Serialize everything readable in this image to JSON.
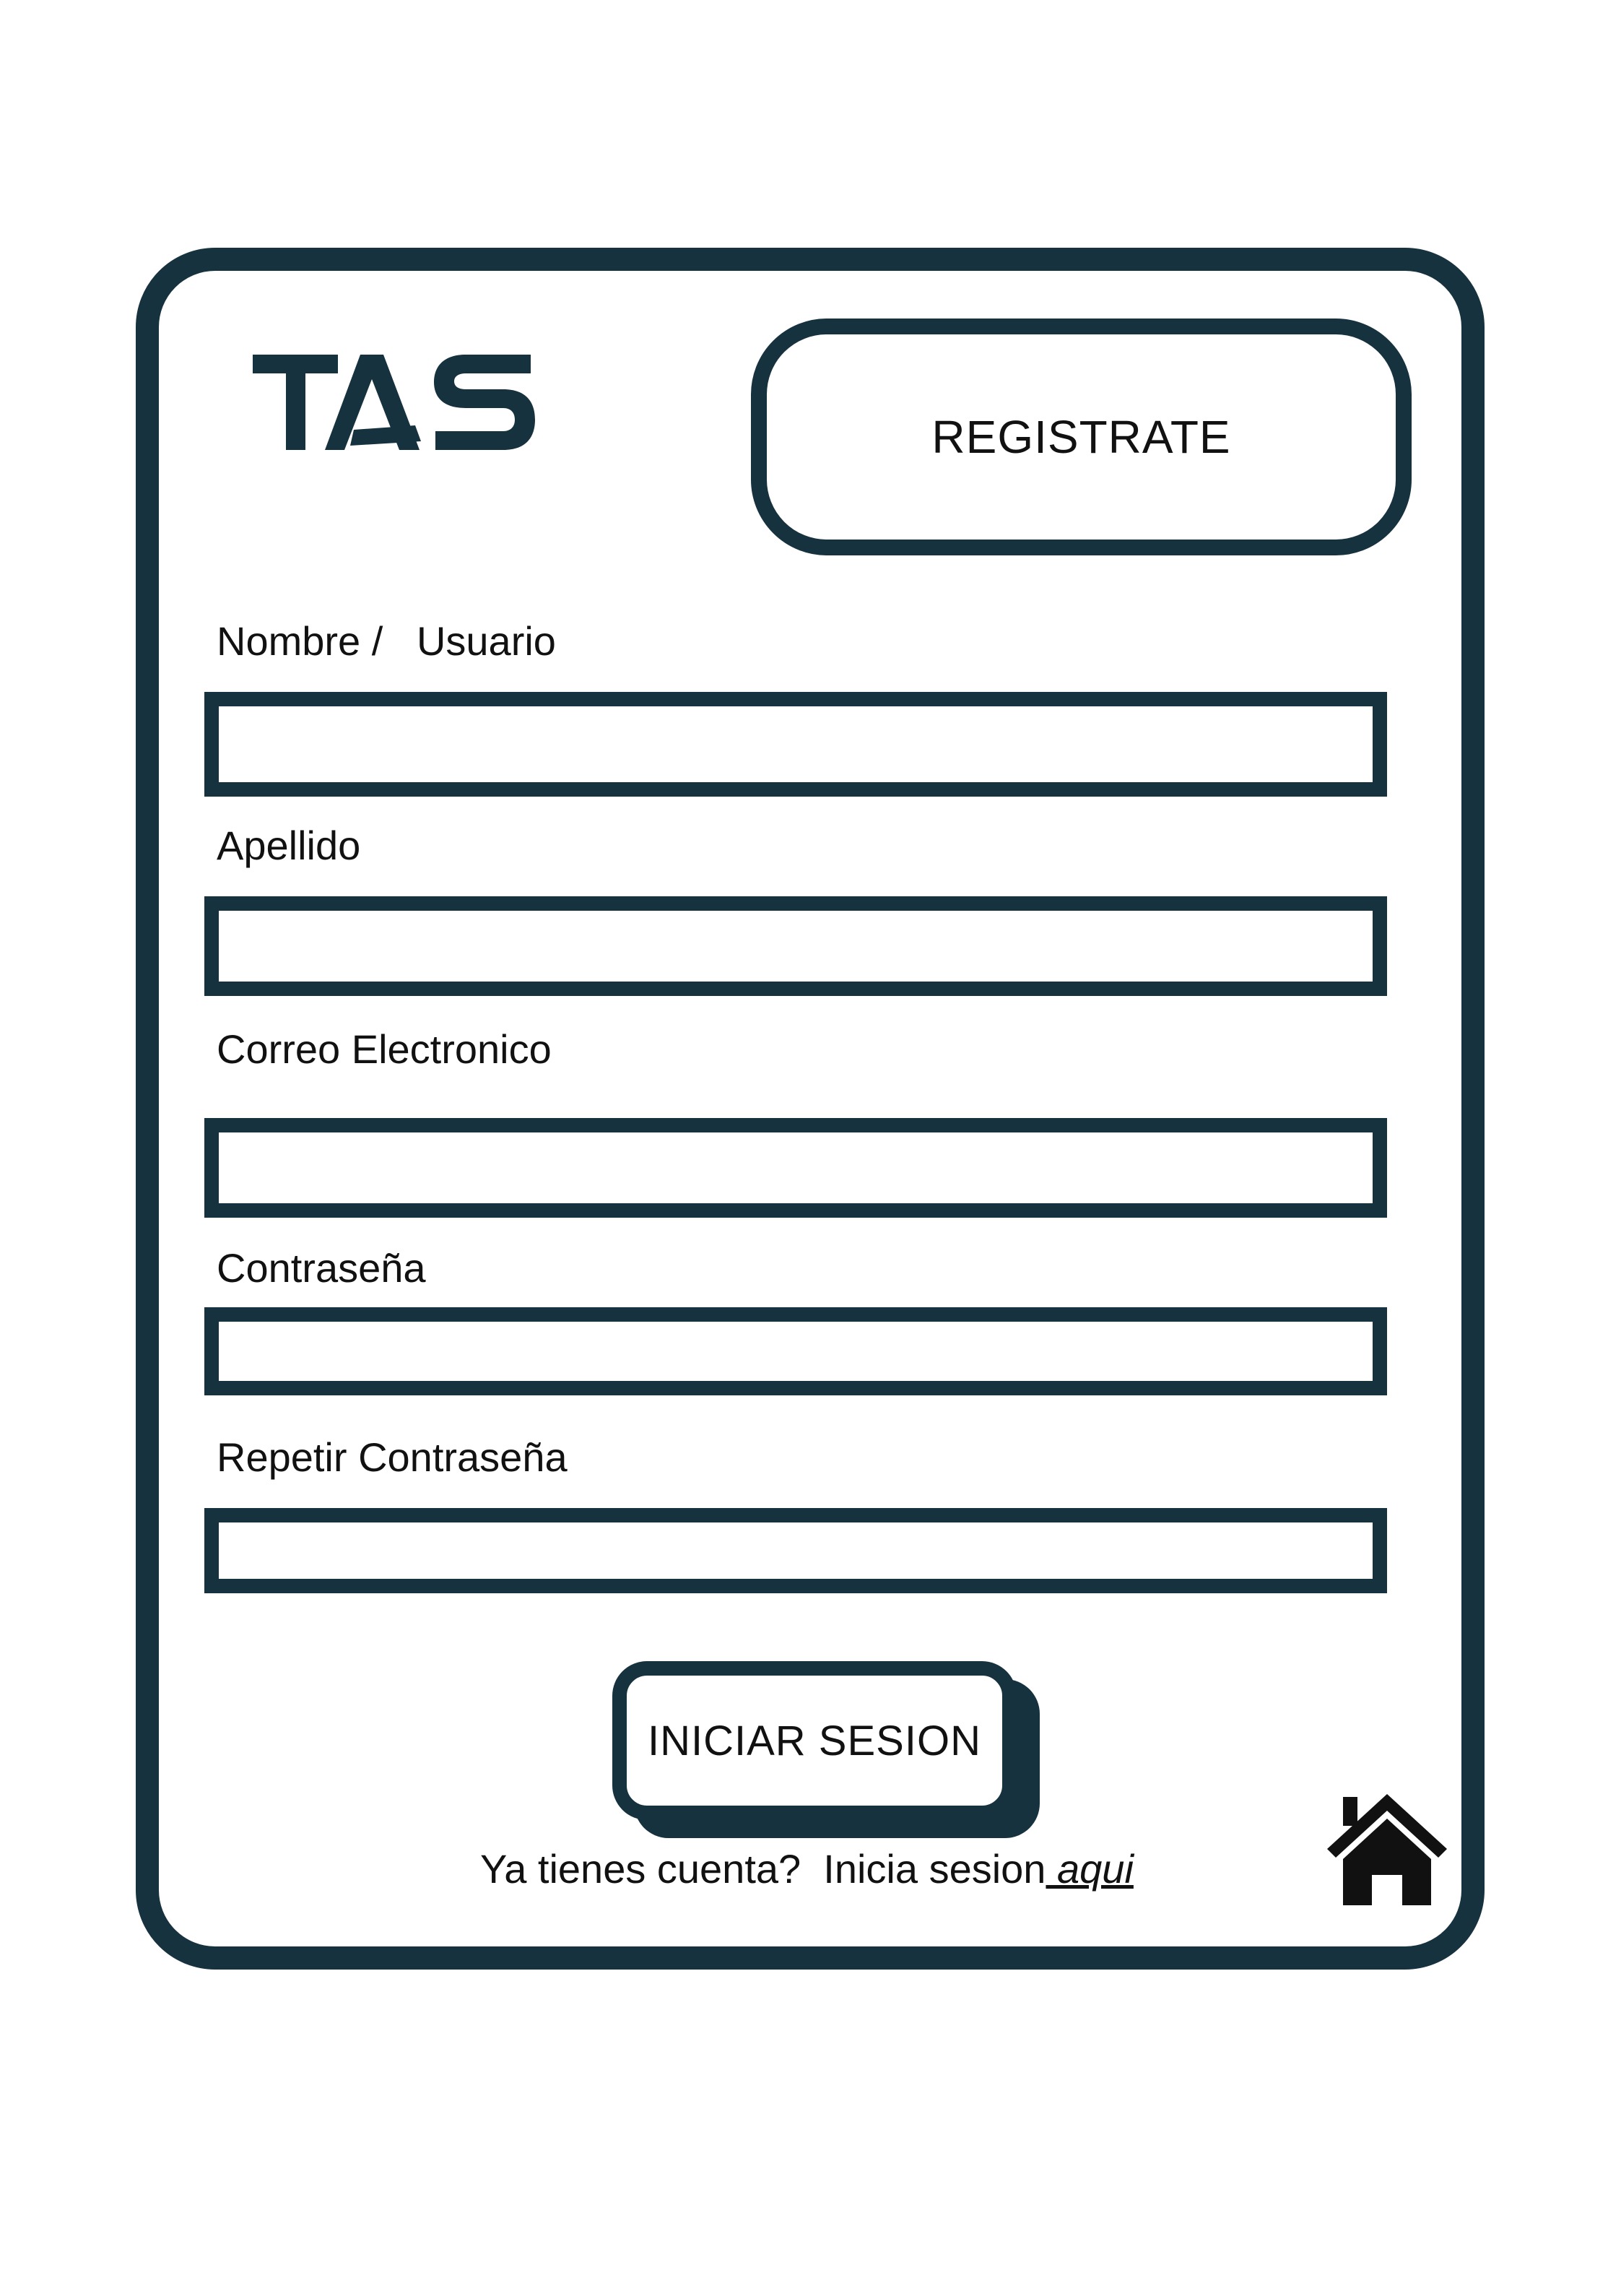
{
  "brand": {
    "logo_text": "TAS",
    "primary_color": "#16323e"
  },
  "header": {
    "register_label": "REGISTRATE"
  },
  "form": {
    "fields": [
      {
        "label": "Nombre /   Usuario",
        "value": "",
        "placeholder": ""
      },
      {
        "label": "Apellido",
        "value": "",
        "placeholder": ""
      },
      {
        "label": "Correo Electronico",
        "value": "",
        "placeholder": ""
      },
      {
        "label": "Contraseña",
        "value": "",
        "placeholder": ""
      },
      {
        "label": "Repetir Contraseña",
        "value": "",
        "placeholder": ""
      }
    ],
    "submit_label": "INICIAR SESION"
  },
  "footer": {
    "prompt": "Ya tienes cuenta?  Inicia sesion",
    "link_label": " aqui"
  },
  "icons": {
    "home": "home-icon"
  }
}
